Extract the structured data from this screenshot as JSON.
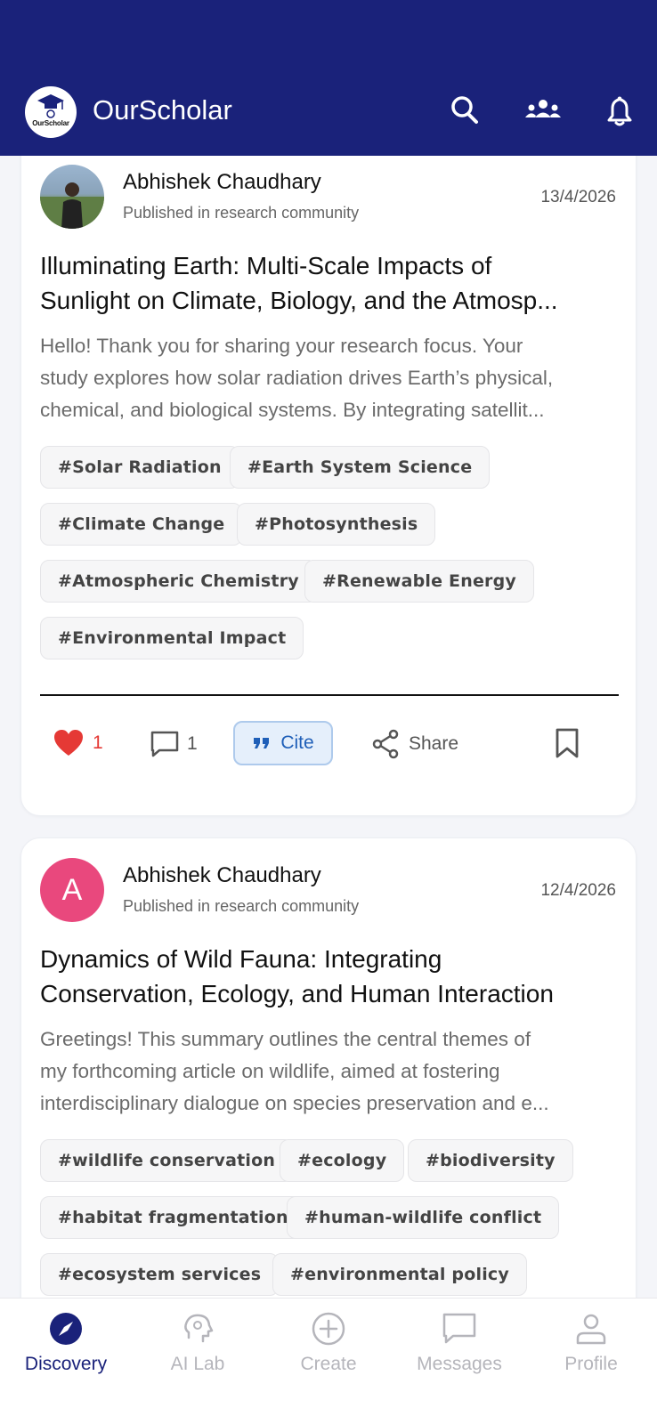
{
  "app": {
    "title": "OurScholar",
    "logo_text": "OurScholar"
  },
  "header": {
    "icons": [
      "search-icon",
      "community-icon",
      "bell-icon"
    ]
  },
  "posts": [
    {
      "author": "Abhishek Chaudhary",
      "published_in": "Published in research community",
      "date": "13/4/2026",
      "title_line1": "Illuminating Earth: Multi-Scale Impacts of",
      "title_line2": "Sunlight on Climate, Biology, and the Atmosp...",
      "excerpt_line1": "Hello! Thank you for sharing your research focus. Your",
      "excerpt_line2": "study explores how solar radiation drives Earth’s physical,",
      "excerpt_line3": "chemical, and biological systems. By integrating satellit...",
      "tags": [
        "#Solar Radiation",
        "#Earth System Science",
        "#Climate Change",
        "#Photosynthesis",
        "#Atmospheric Chemistry",
        "#Renewable Energy",
        "#Environmental Impact"
      ],
      "likes": "1",
      "comments": "1",
      "cite_label": "Cite",
      "share_label": "Share"
    },
    {
      "author": "Abhishek Chaudhary",
      "avatar_letter": "A",
      "published_in": "Published in research community",
      "date": "12/4/2026",
      "title_line1": "Dynamics of Wild Fauna: Integrating",
      "title_line2": "Conservation, Ecology, and Human Interaction",
      "excerpt_line1": "Greetings! This summary outlines the central themes of",
      "excerpt_line2": "my forthcoming article on wildlife, aimed at fostering",
      "excerpt_line3": "interdisciplinary dialogue on species preservation and e...",
      "tags": [
        "#wildlife conservation",
        "#ecology",
        "#biodiversity",
        "#habitat fragmentation",
        "#human-wildlife conflict",
        "#ecosystem services",
        "#environmental policy"
      ]
    }
  ],
  "nav": [
    {
      "label": "Discovery",
      "active": true
    },
    {
      "label": "AI Lab"
    },
    {
      "label": "Create"
    },
    {
      "label": "Messages"
    },
    {
      "label": "Profile"
    }
  ],
  "colors": {
    "header": "#1a227a",
    "active_nav": "#1a227a",
    "like": "#e53935",
    "cite": "#1f5fb8",
    "avatar_a": "#e9487d"
  }
}
